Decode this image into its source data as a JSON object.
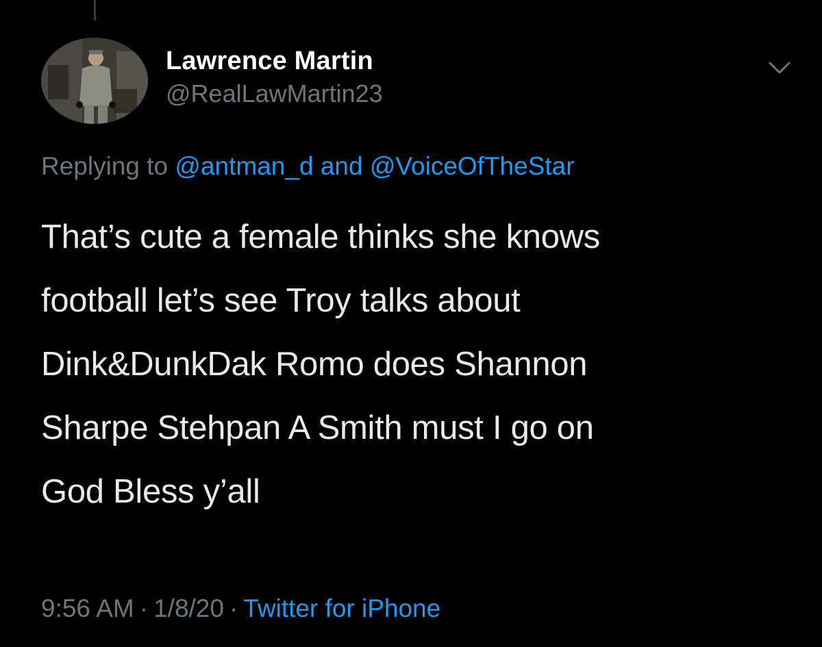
{
  "tweet": {
    "author": {
      "display_name": "Lawrence Martin",
      "handle": "@RealLawMartin23",
      "avatar_icon": "profile-photo"
    },
    "menu_icon": "chevron-down-icon",
    "reply": {
      "prefix": "Replying to",
      "mention_1": "@antman_d",
      "conjunction": "and",
      "mention_2": "@VoiceOfTheStar"
    },
    "text_lines": [
      "That’s cute a female thinks she knows",
      "football let’s see Troy talks about",
      "Dink&DunkDak Romo does Shannon",
      "Sharpe Stehpan A Smith must I go on",
      "God Bless y’all"
    ],
    "time": "9:56 AM",
    "date": "1/8/20",
    "separator": "·",
    "source": "Twitter for iPhone",
    "colors": {
      "background": "#000000",
      "link": "#1d9bf0",
      "muted": "#6e767d",
      "text": "#e7e9ea"
    }
  }
}
